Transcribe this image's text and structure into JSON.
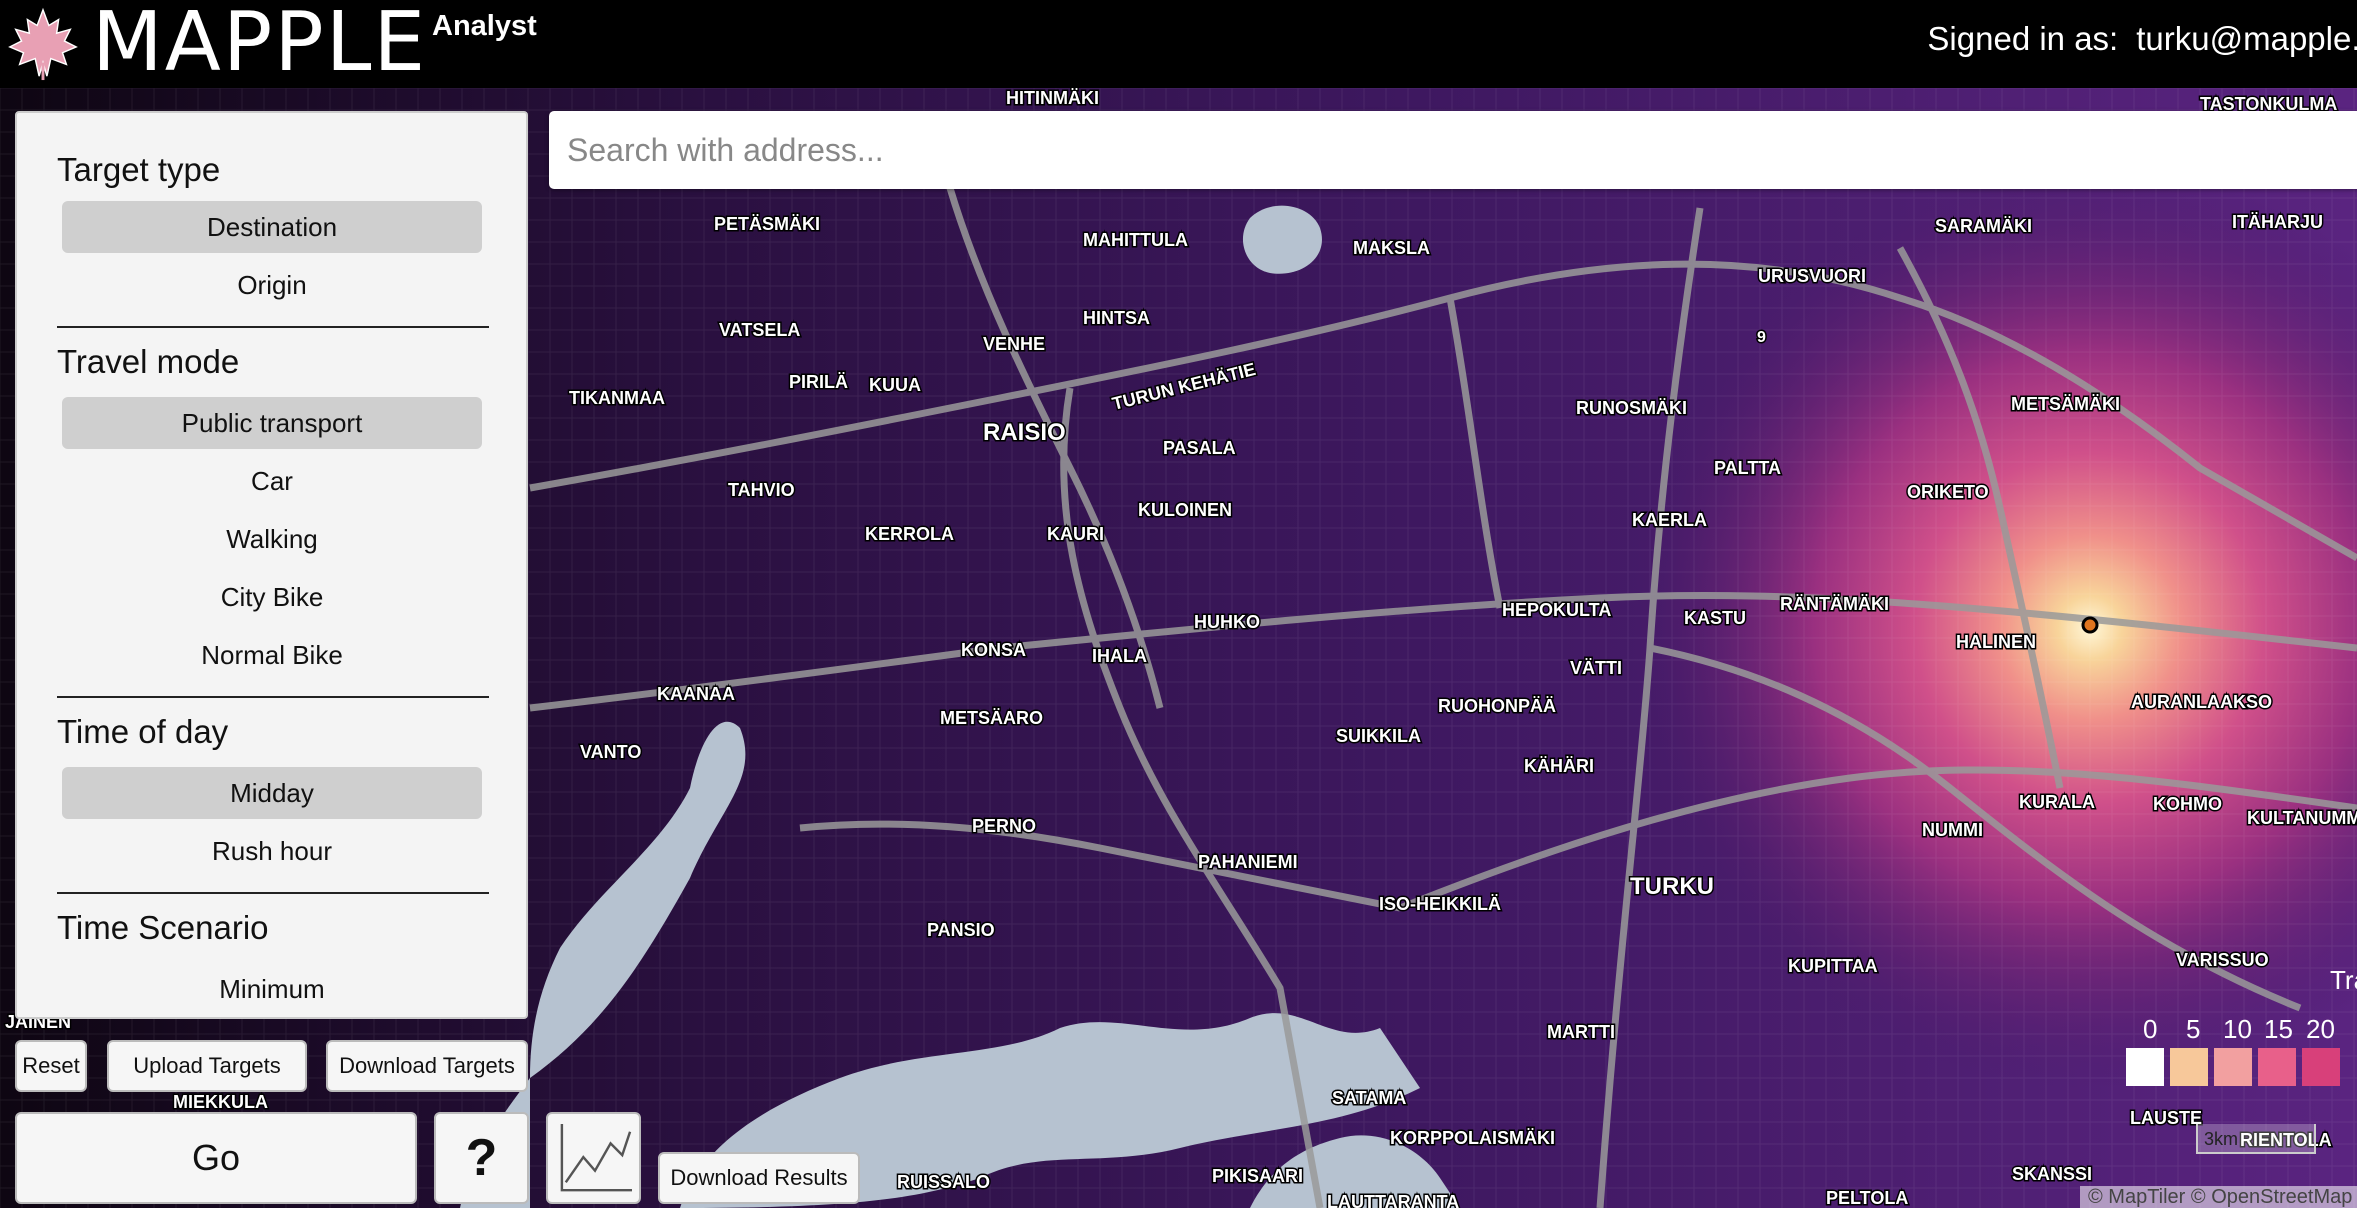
{
  "header": {
    "brand": "MAPPLE",
    "brand_sub": "Analyst",
    "signed_in_label": "Signed in as:",
    "user_email": "turku@mapple.fi",
    "logo_icon": "maple-leaf-icon"
  },
  "search": {
    "placeholder": "Search with address..."
  },
  "panel": {
    "target_type": {
      "title": "Target type",
      "options": [
        "Destination",
        "Origin"
      ],
      "selected": "Destination"
    },
    "travel_mode": {
      "title": "Travel mode",
      "options": [
        "Public transport",
        "Car",
        "Walking",
        "City Bike",
        "Normal Bike"
      ],
      "selected": "Public transport"
    },
    "time_of_day": {
      "title": "Time of day",
      "options": [
        "Midday",
        "Rush hour"
      ],
      "selected": "Midday"
    },
    "time_scenario": {
      "title": "Time Scenario",
      "options": [
        "Minimum"
      ]
    }
  },
  "buttons": {
    "reset": "Reset",
    "upload_targets": "Upload Targets",
    "download_targets": "Download Targets",
    "go": "Go",
    "help": "?",
    "chart_icon": "line-chart-icon",
    "download_results": "Download Results"
  },
  "legend": {
    "title": "Trave",
    "ticks": [
      "0",
      "5",
      "10",
      "15",
      "20"
    ],
    "colors": [
      "#ffffff",
      "#f7c89a",
      "#f2a0a0",
      "#e8608a",
      "#d8407a"
    ]
  },
  "scale_bar": "3km",
  "attribution": "© MapTiler © OpenStreetMap",
  "map": {
    "labels": [
      "HITINMÄKI",
      "TASTONKULMA",
      "PETÄSMÄKI",
      "MAHITTULA",
      "MAKSLA",
      "SARAMÄKI",
      "URUSVUORI",
      "VATSELA",
      "HINTSA",
      "VENHE",
      "PIRILÄ",
      "KUUA",
      "TIKANMAA",
      "TURUN KEHÄTIE",
      "RUNOSMÄKI",
      "METSÄMÄKI",
      "RAISIO",
      "PASALA",
      "PALTTA",
      "TAHVIO",
      "ORIKETO",
      "KULOINEN",
      "KAERLA",
      "KERROLA",
      "KAURI",
      "RÄNTÄMÄKI",
      "HUHKO",
      "HEPOKULTA",
      "KASTU",
      "HALINEN",
      "KONSA",
      "IHALA",
      "VÄTTI",
      "KAANAA",
      "RUOHONPÄÄ",
      "AURANLAAKSO",
      "METSÄARO",
      "SUIKKILA",
      "KÄHÄRI",
      "VANTO",
      "KURALA",
      "KOHMO",
      "KULTANUMMI",
      "PERNO",
      "NUMMI",
      "PAHANIEMI",
      "TURKU",
      "ISO-HEIKKILÄ",
      "PANSIO",
      "KUPITTAA",
      "VARISSUO",
      "MARTTI",
      "SATAMA",
      "KORPPOLAISMÄKI",
      "LAUSTE",
      "PIKISAARI",
      "RUISSALO",
      "SKANSSI",
      "PELTOLA",
      "LAUTTARANTA",
      "ITÄHARJU",
      "MIEKKULA",
      "JÄINEN",
      "RIENTOLA"
    ],
    "road_number": "9"
  }
}
